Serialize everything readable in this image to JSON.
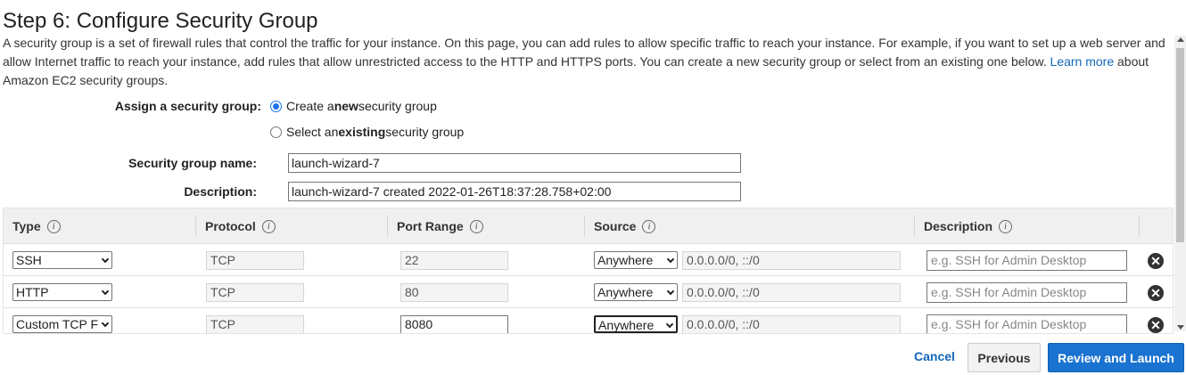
{
  "page": {
    "title": "Step 6: Configure Security Group",
    "intro_text": "A security group is a set of firewall rules that control the traffic for your instance. On this page, you can add rules to allow specific traffic to reach your instance. For example, if you want to set up a web server and allow Internet traffic to reach your instance, add rules that allow unrestricted access to the HTTP and HTTPS ports. You can create a new security group or select from an existing one below.",
    "learn_more_label": "Learn more",
    "intro_suffix": "about Amazon EC2 security groups."
  },
  "assign": {
    "label": "Assign a security group:",
    "options": [
      {
        "prefix": "Create a ",
        "bold": "new",
        "suffix": " security group",
        "checked": true
      },
      {
        "prefix": "Select an ",
        "bold": "existing",
        "suffix": " security group",
        "checked": false
      }
    ]
  },
  "form": {
    "name_label": "Security group name:",
    "name_value": "launch-wizard-7",
    "description_label": "Description:",
    "description_value": "launch-wizard-7 created 2022-01-26T18:37:28.758+02:00"
  },
  "table": {
    "columns": [
      "Type",
      "Protocol",
      "Port Range",
      "Source",
      "Description"
    ],
    "info_icon": "i",
    "rows": [
      {
        "type": "SSH",
        "protocol": "TCP",
        "port": "22",
        "source": "Anywhere",
        "cidr": "0.0.0.0/0, ::/0",
        "desc_placeholder": "e.g. SSH for Admin Desktop"
      },
      {
        "type": "HTTP",
        "protocol": "TCP",
        "port": "80",
        "source": "Anywhere",
        "cidr": "0.0.0.0/0, ::/0",
        "desc_placeholder": "e.g. SSH for Admin Desktop"
      },
      {
        "type": "Custom TCP F",
        "protocol": "TCP",
        "port": "8080",
        "source": "Anywhere",
        "cidr": "0.0.0.0/0, ::/0",
        "desc_placeholder": "e.g. SSH for Admin Desktop"
      }
    ],
    "remove_icon": "✕"
  },
  "footer": {
    "cancel_label": "Cancel",
    "previous_label": "Previous",
    "launch_label": "Review and Launch"
  },
  "colors": {
    "primary": "#1a73d0",
    "link": "#1166bb",
    "radio_checked": "#1a73e8"
  }
}
